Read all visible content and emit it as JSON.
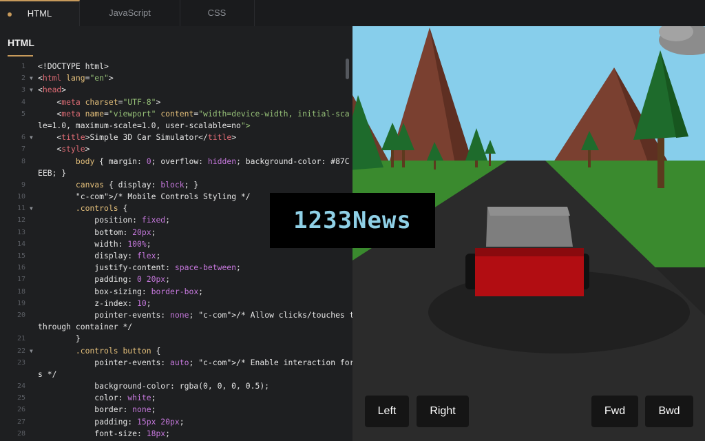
{
  "tabs": [
    {
      "label": "HTML",
      "active": true
    },
    {
      "label": "JavaScript",
      "active": false
    },
    {
      "label": "CSS",
      "active": false
    }
  ],
  "editor": {
    "title": "HTML",
    "line_numbers": [
      "1",
      "2",
      "3",
      "4",
      "5",
      "",
      "6",
      "7",
      "8",
      "",
      "9",
      "10",
      "11",
      "12",
      "13",
      "14",
      "15",
      "16",
      "17",
      "18",
      "19",
      "20",
      "",
      "21",
      "22",
      "23",
      "",
      "24",
      "25",
      "26",
      "27",
      "28"
    ],
    "lines": [
      "<!DOCTYPE html>",
      "<html lang=\"en\">",
      "<head>",
      "    <meta charset=\"UTF-8\">",
      "    <meta name=\"viewport\" content=\"width=device-width, initial-sca",
      "le=1.0, maximum-scale=1.0, user-scalable=no\">",
      "    <title>Simple 3D Car Simulator</title>",
      "    <style>",
      "        body { margin: 0; overflow: hidden; background-color: #87C",
      "EEB; }",
      "        canvas { display: block; }",
      "        /* Mobile Controls Styling */",
      "        .controls {",
      "            position: fixed;",
      "            bottom: 20px;",
      "            width: 100%;",
      "            display: flex;",
      "            justify-content: space-between;",
      "            padding: 0 20px;",
      "            box-sizing: border-box;",
      "            z-index: 10;",
      "            pointer-events: none; /* Allow clicks/touches to pass",
      "through container */",
      "        }",
      "        .controls button {",
      "            pointer-events: auto; /* Enable interaction for button",
      "s */",
      "            background-color: rgba(0, 0, 0, 0.5);",
      "            color: white;",
      "            border: none;",
      "            padding: 15px 20px;",
      "            font-size: 18px;"
    ]
  },
  "preview": {
    "buttons": {
      "left": "Left",
      "right": "Right",
      "fwd": "Fwd",
      "bwd": "Bwd"
    }
  },
  "watermark": "1233News",
  "colors": {
    "accent": "#c79a5b",
    "sky": "#87CEEB",
    "grass": "#3a8a2e",
    "road": "#2b2b2b",
    "car_body": "#b20d12",
    "car_top": "#7e7e7e"
  }
}
